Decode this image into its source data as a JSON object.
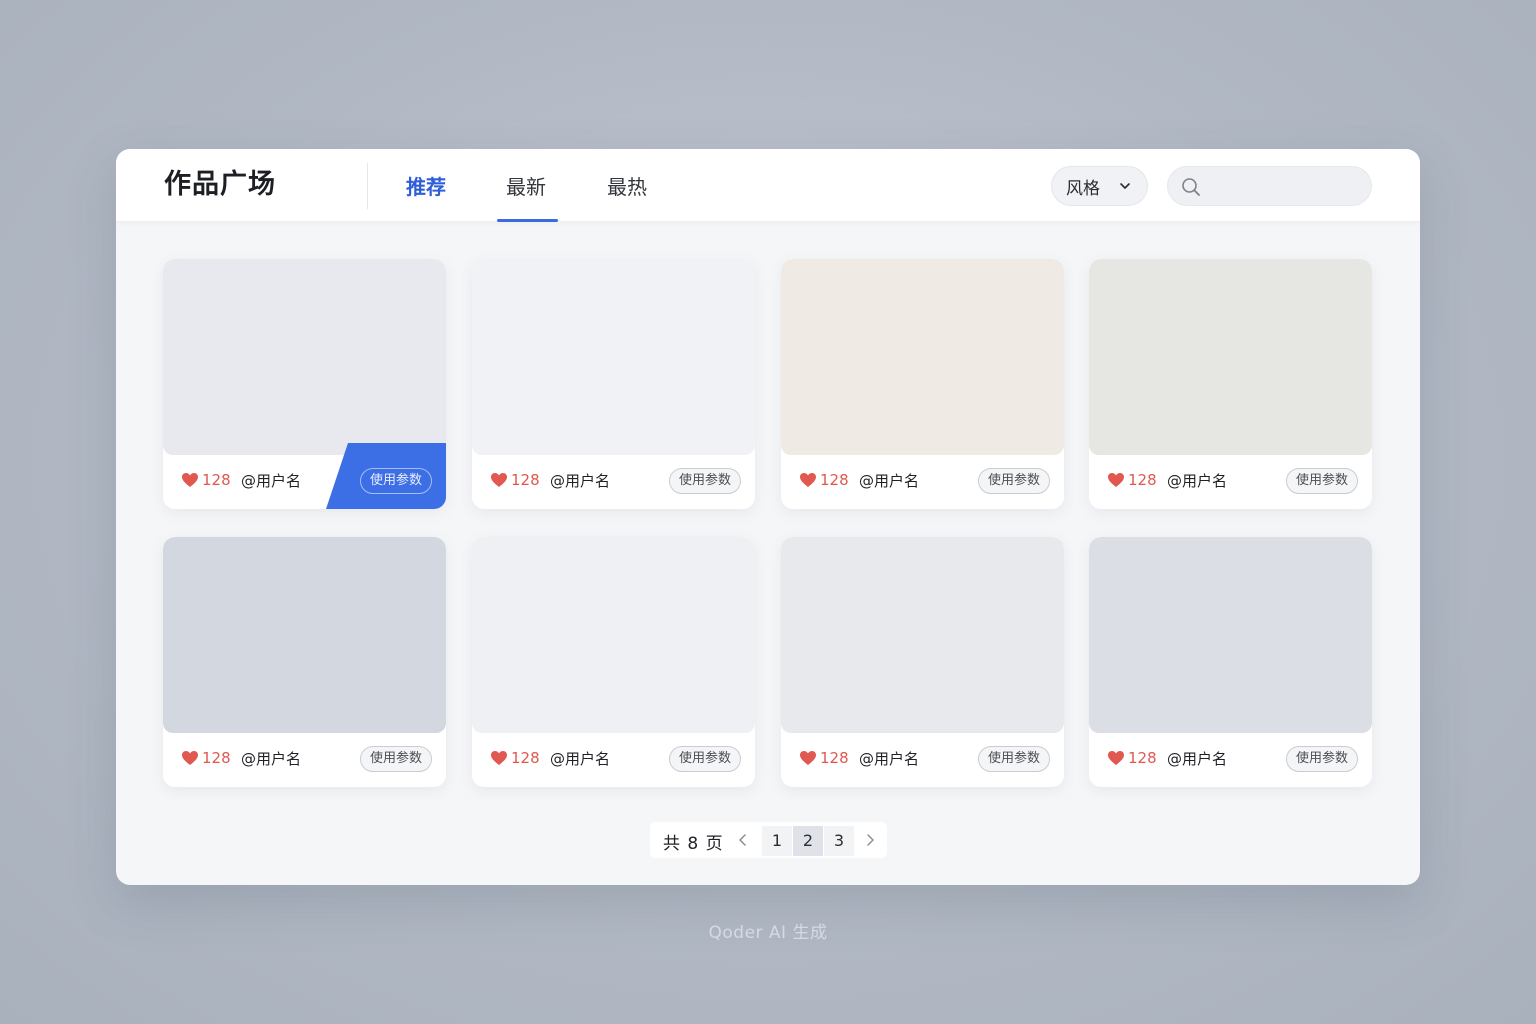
{
  "header": {
    "title": "作品广场",
    "tabs": [
      {
        "label": "推荐",
        "active": true
      },
      {
        "label": "最新",
        "active": false
      },
      {
        "label": "最热",
        "active": false
      }
    ],
    "style_filter": {
      "label": "风格"
    },
    "search": {
      "placeholder": "",
      "value": ""
    }
  },
  "cards": [
    {
      "likes": "128",
      "user": "@用户名",
      "button": "使用参数",
      "thumb_color": "#e8e9ee",
      "highlighted": true
    },
    {
      "likes": "128",
      "user": "@用户名",
      "button": "使用参数",
      "thumb_color": "#f1f2f5",
      "highlighted": false
    },
    {
      "likes": "128",
      "user": "@用户名",
      "button": "使用参数",
      "thumb_color": "#efebe4",
      "highlighted": false
    },
    {
      "likes": "128",
      "user": "@用户名",
      "button": "使用参数",
      "thumb_color": "#e6e6e3",
      "highlighted": false
    },
    {
      "likes": "128",
      "user": "@用户名",
      "button": "使用参数",
      "thumb_color": "#d3d7e0",
      "highlighted": false
    },
    {
      "likes": "128",
      "user": "@用户名",
      "button": "使用参数",
      "thumb_color": "#eff0f3",
      "highlighted": false
    },
    {
      "likes": "128",
      "user": "@用户名",
      "button": "使用参数",
      "thumb_color": "#e8e9ed",
      "highlighted": false
    },
    {
      "likes": "128",
      "user": "@用户名",
      "button": "使用参数",
      "thumb_color": "#dcdee5",
      "highlighted": false
    }
  ],
  "pagination": {
    "total_label": "共 8 页",
    "pages": [
      "1",
      "2",
      "3"
    ],
    "current": "2"
  },
  "footer": {
    "note": "Qoder AI 生成"
  },
  "colors": {
    "accent": "#3c6ee6",
    "like": "#e0584f"
  }
}
